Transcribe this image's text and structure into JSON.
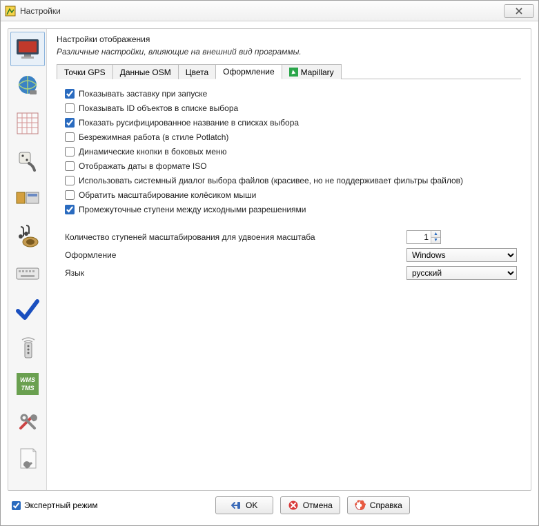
{
  "window": {
    "title": "Настройки"
  },
  "page": {
    "heading": "Настройки отображения",
    "subtitle": "Различные настройки, влияющие на внешний вид программы."
  },
  "tabs": {
    "gps": "Точки GPS",
    "osm": "Данные OSM",
    "colors": "Цвета",
    "styling": "Оформление",
    "mapillary": "Mapillary"
  },
  "checks": {
    "splash": "Показывать заставку при запуске",
    "showid": "Показывать ID объектов в списке выбора",
    "localized": "Показать русифицированное название в списках выбора",
    "modeless": "Безрежимная работа (в стиле Potlatch)",
    "dynbuttons": "Динамические кнопки в боковых меню",
    "iso": "Отображать даты в формате ISO",
    "sysdialog": "Использовать системный диалог выбора файлов (красивее, но не поддерживает фильтры файлов)",
    "reversewheel": "Обратить масштабирование колёсиком мыши",
    "intermediate": "Промежуточные ступени между исходными разрешениями"
  },
  "fields": {
    "zoom_label": "Количество ступеней масштабирования для удвоения масштаба",
    "zoom_value": "1",
    "theme_label": "Оформление",
    "theme_value": "Windows",
    "lang_label": "Язык",
    "lang_value": "русский"
  },
  "bottom": {
    "expert": "Экспертный режим",
    "ok": "OK",
    "cancel": "Отмена",
    "help": "Справка"
  }
}
